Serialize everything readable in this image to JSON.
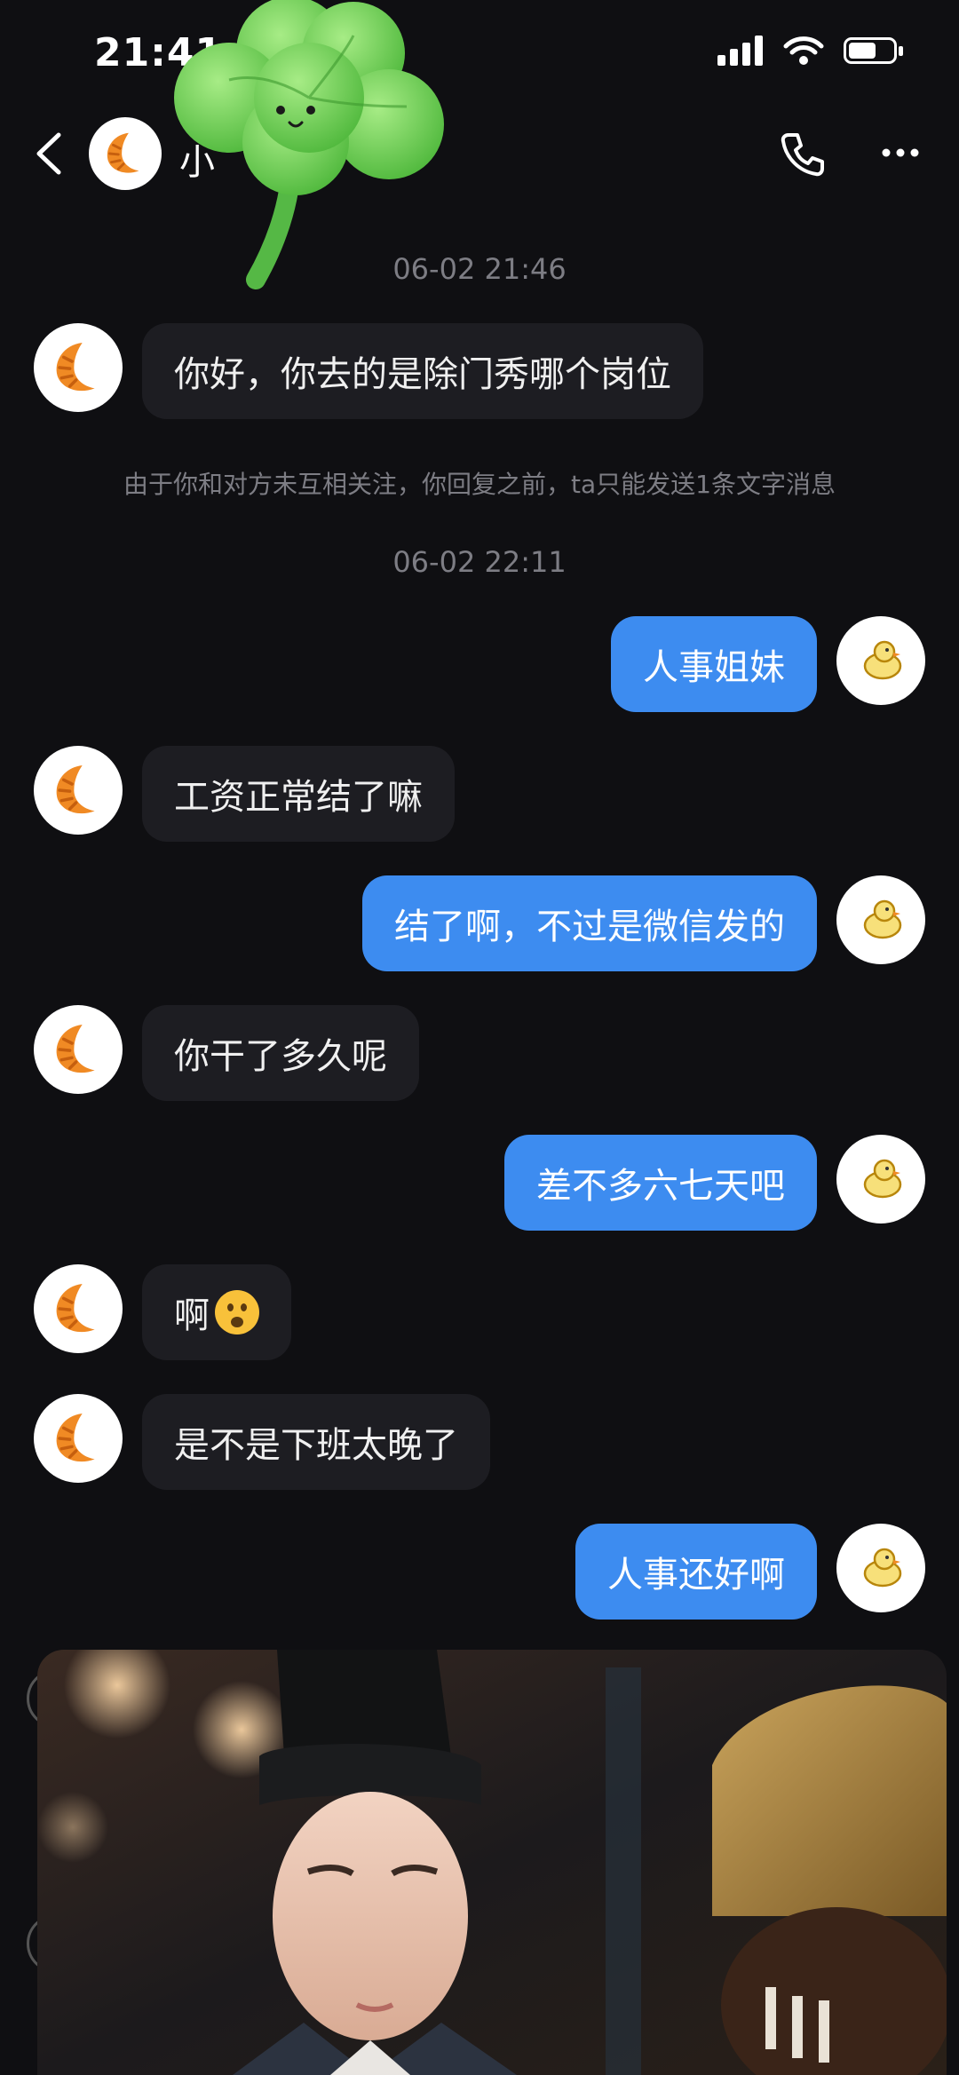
{
  "status_bar": {
    "time": "21:41"
  },
  "header": {
    "contact_name": "小"
  },
  "chat": {
    "timestamp_1": "06-02 21:46",
    "timestamp_2": "06-02 22:11",
    "notice": "由于你和对方未互相关注，你回复之前，ta只能发送1条文字消息",
    "messages": [
      {
        "dir": "in",
        "text": "你好，你去的是除门秀哪个岗位"
      },
      {
        "dir": "out",
        "text": "人事姐妹"
      },
      {
        "dir": "in",
        "text": "工资正常结了嘛"
      },
      {
        "dir": "out",
        "text": "结了啊，不过是微信发的"
      },
      {
        "dir": "in",
        "text": "你干了多久呢"
      },
      {
        "dir": "out",
        "text": "差不多六七天吧"
      },
      {
        "dir": "in",
        "text": "啊",
        "emoji": "astonished-face"
      },
      {
        "dir": "in",
        "text": "是不是下班太晚了"
      },
      {
        "dir": "out",
        "text": "人事还好啊"
      }
    ]
  },
  "icons": {
    "back": "chevron-left-icon",
    "phone": "phone-icon",
    "more": "more-dots-icon",
    "contact_avatar": "croissant-icon",
    "my_avatar": "duck-icon",
    "sticker": "clover-sticker"
  },
  "colors": {
    "background": "#0f0f12",
    "incoming_bubble": "#1d1d22",
    "outgoing_bubble": "#3d8cf0",
    "meta_text": "#7d7d84"
  }
}
